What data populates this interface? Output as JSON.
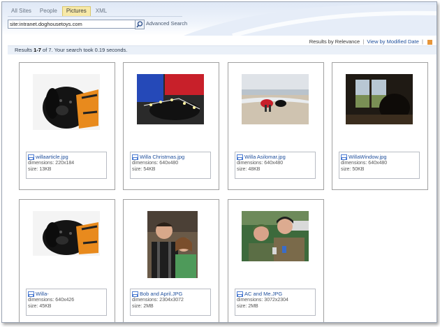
{
  "tabs": [
    {
      "label": "All Sites",
      "active": false
    },
    {
      "label": "People",
      "active": false
    },
    {
      "label": "Pictures",
      "active": true
    },
    {
      "label": "XML",
      "active": false
    }
  ],
  "search": {
    "query": "site:intranet.doghousetoys.com",
    "advanced_label": "Advanced Search"
  },
  "sort": {
    "relevance_label": "Results by Relevance",
    "sep": "|",
    "modified_label": "View by Modified Date",
    "sep2": "|"
  },
  "results": {
    "prefix": "Results ",
    "range": "1-7",
    "of_label": " of ",
    "total": "7",
    "suffix": ". Your search took 0.19 seconds."
  },
  "images": [
    {
      "name": "willaarticle.jpg",
      "dimensions": "dimensions: 220x184",
      "size": "size: 13KB"
    },
    {
      "name": "Willa Christmas.jpg",
      "dimensions": "dimensions: 640x480",
      "size": "size: 54KB"
    },
    {
      "name": "Willa Asilomar.jpg",
      "dimensions": "dimensions: 640x480",
      "size": "size: 48KB"
    },
    {
      "name": "WillaWindow.jpg",
      "dimensions": "dimensions: 640x480",
      "size": "size: 50KB"
    },
    {
      "name": "Willa-",
      "dimensions": "dimensions: 640x426",
      "size": "size: 45KB"
    },
    {
      "name": "Bob and April.JPG",
      "dimensions": "dimensions: 2304x3072",
      "size": "size: 2MB"
    },
    {
      "name": "AC and Me.JPG",
      "dimensions": "dimensions: 3072x2304",
      "size": "size: 2MB"
    }
  ]
}
